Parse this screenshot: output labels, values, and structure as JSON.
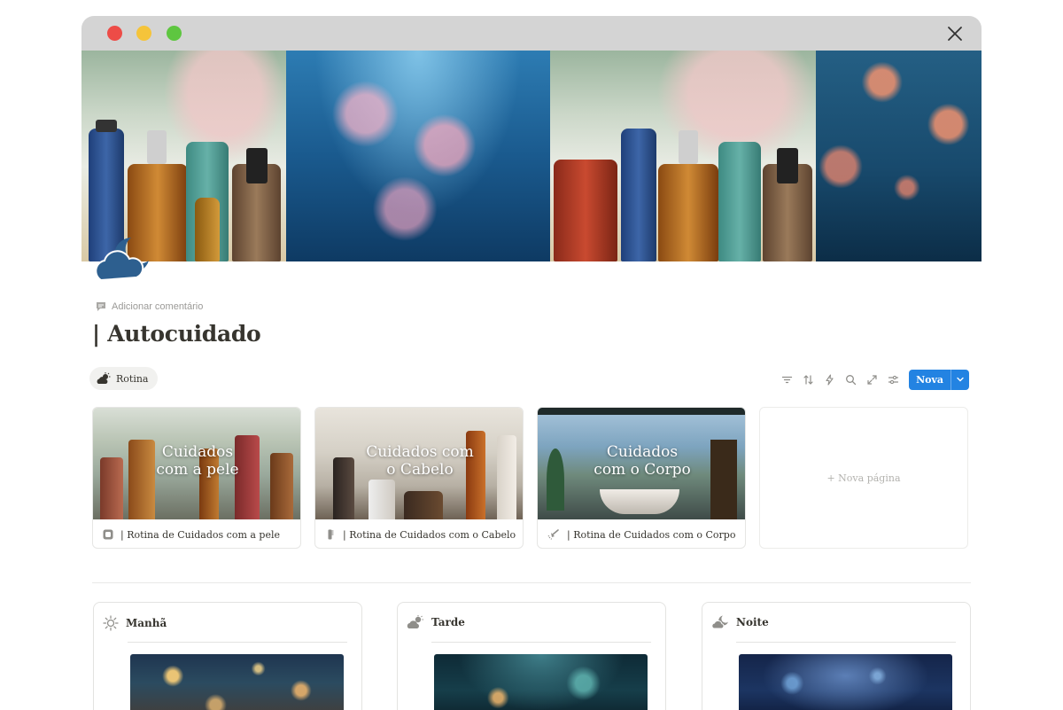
{
  "window": {
    "controls": [
      "close",
      "minimize",
      "zoom"
    ],
    "close_icon": "close-icon"
  },
  "page": {
    "add_comment": "Adicionar comentário",
    "title": "| Autocuidado",
    "icon": "cloud-moon-icon"
  },
  "view": {
    "tab_label": "Rotina",
    "tab_icon": "sun-behind-cloud-icon",
    "toolbar_icons": [
      "filter-icon",
      "sort-icon",
      "lightning-icon",
      "search-icon",
      "expand-icon",
      "settings-icon"
    ],
    "new_label": "Nova",
    "accent_color": "#2383e2"
  },
  "gallery": {
    "cards": [
      {
        "cover_title": "Cuidados\ncom a pele",
        "name": "| Rotina de Cuidados com a pele",
        "icon": "face-icon"
      },
      {
        "cover_title": "Cuidados com\no Cabelo",
        "name": "| Rotina de Cuidados com o Cabelo",
        "icon": "comb-icon"
      },
      {
        "cover_title": "Cuidados\ncom o Corpo",
        "name": "| Rotina de Cuidados com o Corpo",
        "icon": "shower-icon"
      }
    ],
    "new_page_label": "+ Nova página"
  },
  "routines": [
    {
      "label": "Manhã",
      "icon": "sun-icon"
    },
    {
      "label": "Tarde",
      "icon": "sun-behind-cloud-icon"
    },
    {
      "label": "Noite",
      "icon": "moon-cloud-icon"
    }
  ]
}
